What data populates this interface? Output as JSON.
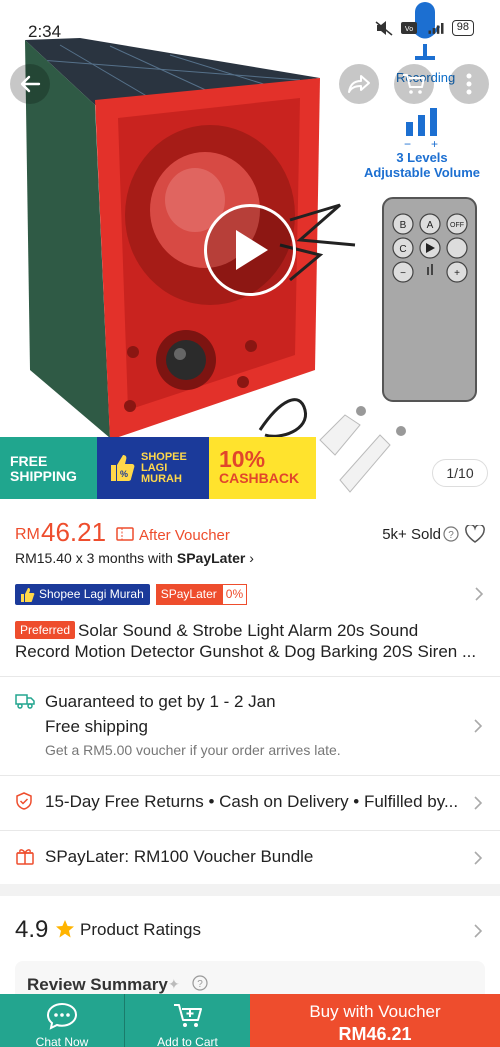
{
  "status_bar": {
    "time": "2:34",
    "battery": "98"
  },
  "media": {
    "recording_label": "Recording",
    "levels_label_1": "3 Levels",
    "levels_label_2": "Adjustable Volume",
    "counter": "1/10",
    "promo_free_shipping_1": "FREE",
    "promo_free_shipping_2": "SHIPPING",
    "promo_shopee_1": "SHOPEE",
    "promo_shopee_2": "LAGI",
    "promo_shopee_3": "MURAH",
    "promo_cashback_value": "10%",
    "promo_cashback_label": "CASHBACK"
  },
  "price": {
    "currency": "RM",
    "value": "46.21",
    "after_voucher": "After Voucher",
    "sold": "5k+ Sold",
    "paylater_prefix": "RM15.40 x 3 months with ",
    "paylater_brand": "SPayLater",
    "paylater_suffix": " ›"
  },
  "tags": {
    "shopee_lagi_murah": "Shopee Lagi Murah",
    "spaylater": "SPayLater",
    "spaylater_pct": "0%"
  },
  "product": {
    "preferred_badge": "Preferred",
    "title_line1": "Solar Sound & Strobe Light Alarm 20s Sound",
    "title_line2": "Record Motion Detector Gunshot & Dog Barking 20S Siren ..."
  },
  "shipping": {
    "line1": "Guaranteed to get by 1 - 2 Jan",
    "line2": "Free shipping",
    "line3": "Get a RM5.00 voucher if your order arrives late."
  },
  "returns": {
    "text": "15-Day Free Returns  •  Cash on Delivery  •  Fulfilled by..."
  },
  "voucher_bundle": {
    "text": "SPayLater: RM100 Voucher Bundle"
  },
  "ratings": {
    "score": "4.9",
    "label": "Product Ratings"
  },
  "review_summary": {
    "title": "Review Summary"
  },
  "bottom_bar": {
    "chat_label": "Chat Now",
    "cart_label": "Add to Cart",
    "buy_label": "Buy with Voucher",
    "buy_price": "RM46.21"
  },
  "colors": {
    "accent": "#ee4d2d",
    "teal": "#23a58f",
    "navy": "#1b3a9a"
  }
}
